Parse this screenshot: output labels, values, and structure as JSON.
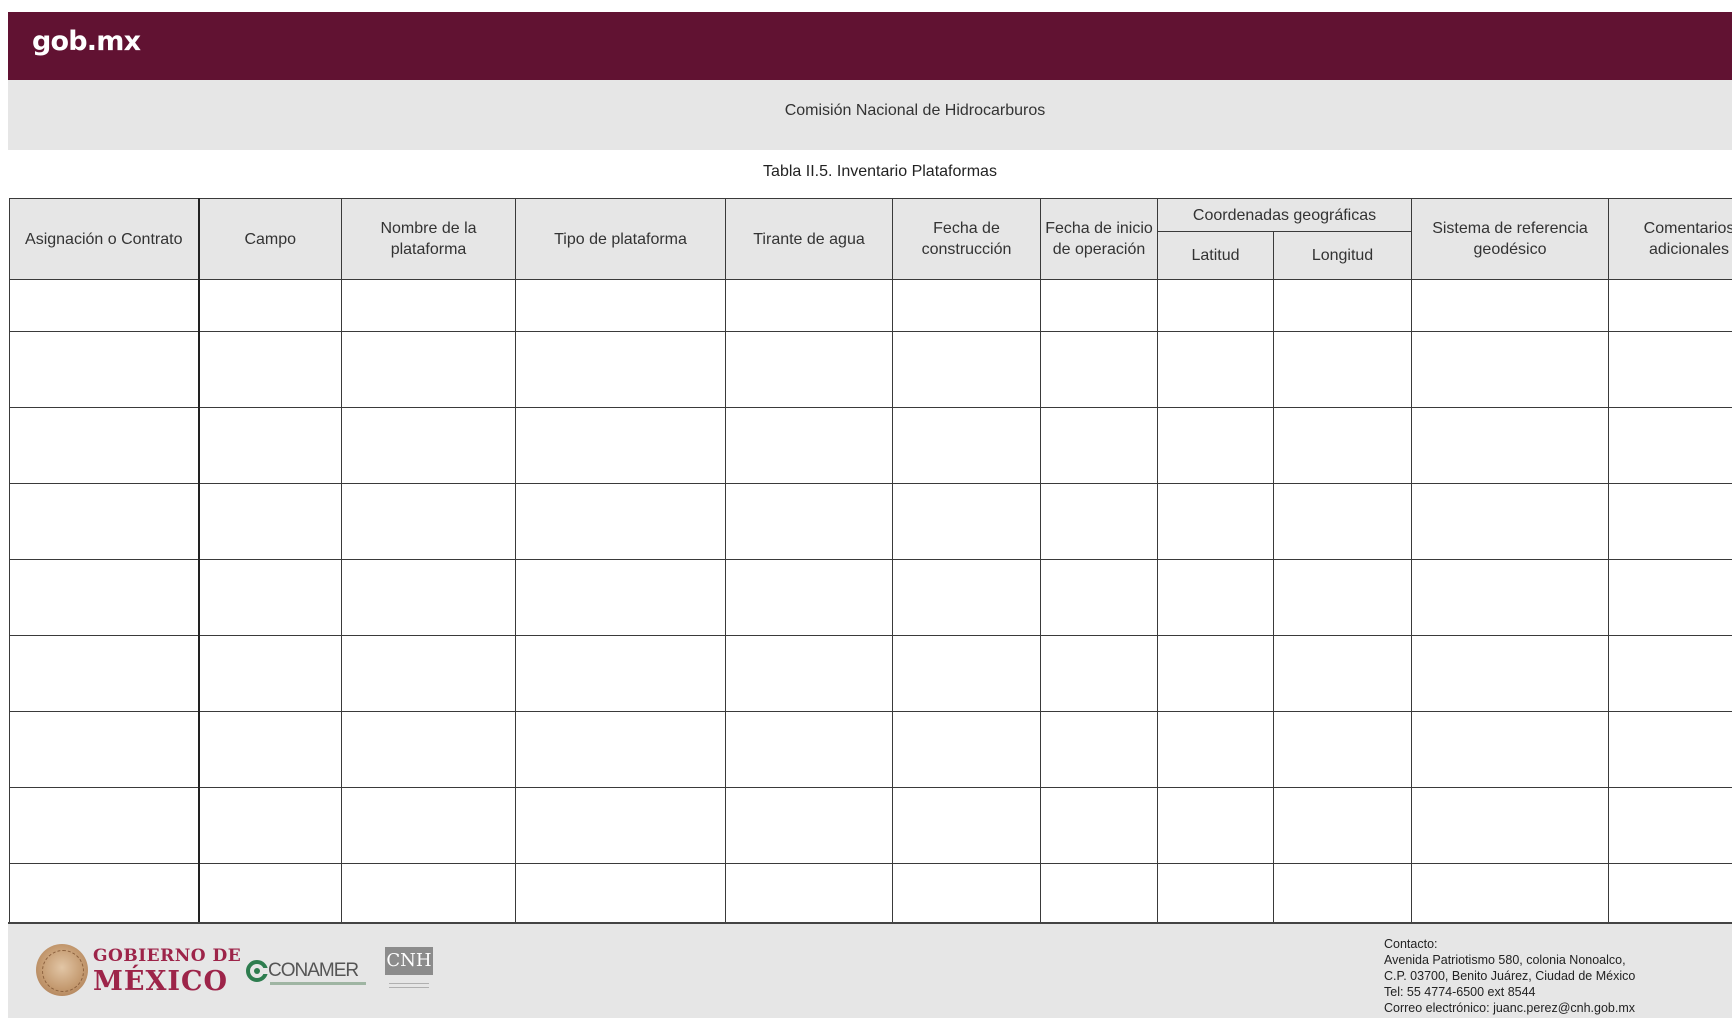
{
  "header": {
    "logo_text": "gob.mx"
  },
  "subheader": {
    "organization": "Comisión Nacional de Hidrocarburos"
  },
  "table": {
    "title": "Tabla II.5. Inventario Plataformas",
    "headers": {
      "asignacion": "Asignación o Contrato",
      "campo": "Campo",
      "nombre": "Nombre de la plataforma",
      "tipo": "Tipo de plataforma",
      "tirante": "Tirante de agua",
      "fecha_construccion": "Fecha de construcción",
      "fecha_inicio": "Fecha de inicio de operación",
      "coordenadas": "Coordenadas geográficas",
      "latitud": "Latitud",
      "longitud": "Longitud",
      "sistema": "Sistema de referencia geodésico",
      "comentarios": "Comentarios adicionales"
    },
    "empty_row_count": 9
  },
  "footer": {
    "gobierno_line1": "GOBIERNO DE",
    "gobierno_line2": "MÉXICO",
    "conamer": "CONAMER",
    "cnh": "CNH",
    "contact": {
      "label": "Contacto:",
      "address1": "Avenida Patriotismo 580, colonia Nonoalco,",
      "address2": "C.P. 03700, Benito Juárez, Ciudad de México",
      "phone": "Tel: 55 4774-6500 ext 8544",
      "email": "Correo electrónico: juanc.perez@cnh.gob.mx"
    }
  },
  "colors": {
    "header_bg": "#611232",
    "band_gray": "#e6e6e6",
    "brand_red": "#9d2449"
  }
}
